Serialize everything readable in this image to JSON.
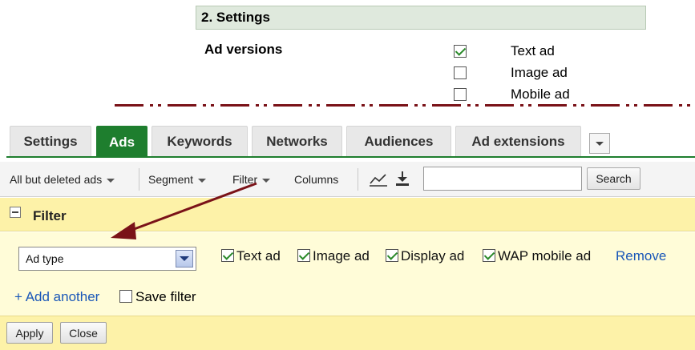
{
  "settings": {
    "header": "2. Settings",
    "ad_versions_label": "Ad versions",
    "versions": [
      {
        "label": "Text ad",
        "checked": true
      },
      {
        "label": "Image ad",
        "checked": false
      },
      {
        "label": "Mobile ad",
        "checked": false
      }
    ]
  },
  "tabs": [
    {
      "label": "Settings",
      "active": false
    },
    {
      "label": "Ads",
      "active": true
    },
    {
      "label": "Keywords",
      "active": false
    },
    {
      "label": "Networks",
      "active": false
    },
    {
      "label": "Audiences",
      "active": false
    },
    {
      "label": "Ad extensions",
      "active": false
    }
  ],
  "toolbar": {
    "view_filter": "All but deleted ads",
    "segment": "Segment",
    "filter": "Filter",
    "columns": "Columns",
    "search_value": "",
    "search_button": "Search",
    "icons": [
      "graph-icon",
      "download-icon"
    ]
  },
  "filter_panel": {
    "title": "Filter",
    "select_value": "Ad type",
    "ad_types": [
      {
        "label": "Text ad",
        "checked": true
      },
      {
        "label": "Image ad",
        "checked": true
      },
      {
        "label": "Display ad",
        "checked": true
      },
      {
        "label": "WAP mobile ad",
        "checked": true
      }
    ],
    "remove_label": "Remove",
    "add_another_label": "+ Add another",
    "save_filter_label": "Save filter",
    "save_filter_checked": false,
    "apply_label": "Apply",
    "close_label": "Close"
  },
  "colors": {
    "active_tab": "#1e7e2e",
    "panel_yellow": "#fdf2a8",
    "link_blue": "#1a57b8",
    "arrow": "#7a1218"
  }
}
